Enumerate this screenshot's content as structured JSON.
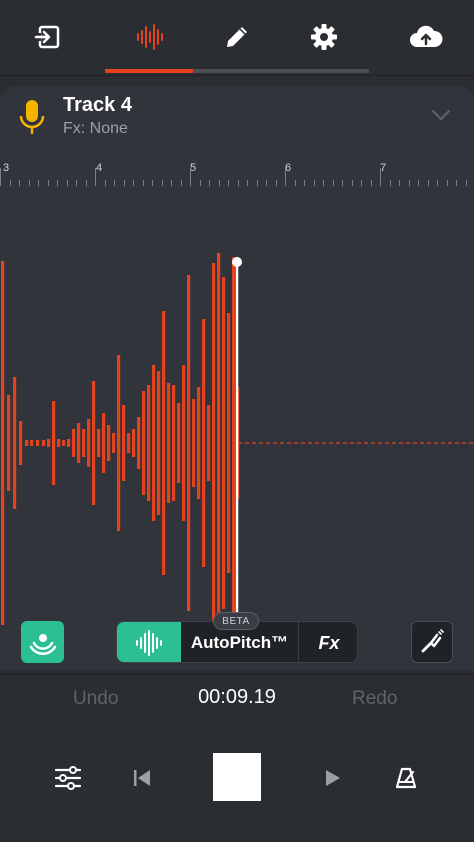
{
  "nav": {
    "tabs": [
      {
        "icon": "exit-icon",
        "active": false
      },
      {
        "icon": "waveform-icon",
        "active": true
      },
      {
        "icon": "pencil-icon",
        "active": false
      },
      {
        "icon": "gear-icon",
        "active": false
      },
      {
        "icon": "cloud-upload-icon",
        "active": false
      }
    ],
    "active_color": "#e2431e"
  },
  "track": {
    "name": "Track 4",
    "fx": "Fx: None",
    "mic_color": "#f5b400"
  },
  "ruler": {
    "labels": [
      "3",
      "4",
      "5",
      "6",
      "7"
    ]
  },
  "waveform": {
    "color": "#e2431e",
    "playhead_color": "#ffffff"
  },
  "tools": {
    "beta_label": "BETA",
    "autopitch_label": "AutoPitch™",
    "fx_label": "Fx",
    "accent": "#2dbf94"
  },
  "edit": {
    "undo_label": "Undo",
    "time": "00:09.19",
    "redo_label": "Redo"
  },
  "transport": {
    "buttons": [
      "mixer-sliders-icon",
      "skip-back-icon",
      "stop-icon",
      "play-icon",
      "metronome-icon"
    ]
  }
}
